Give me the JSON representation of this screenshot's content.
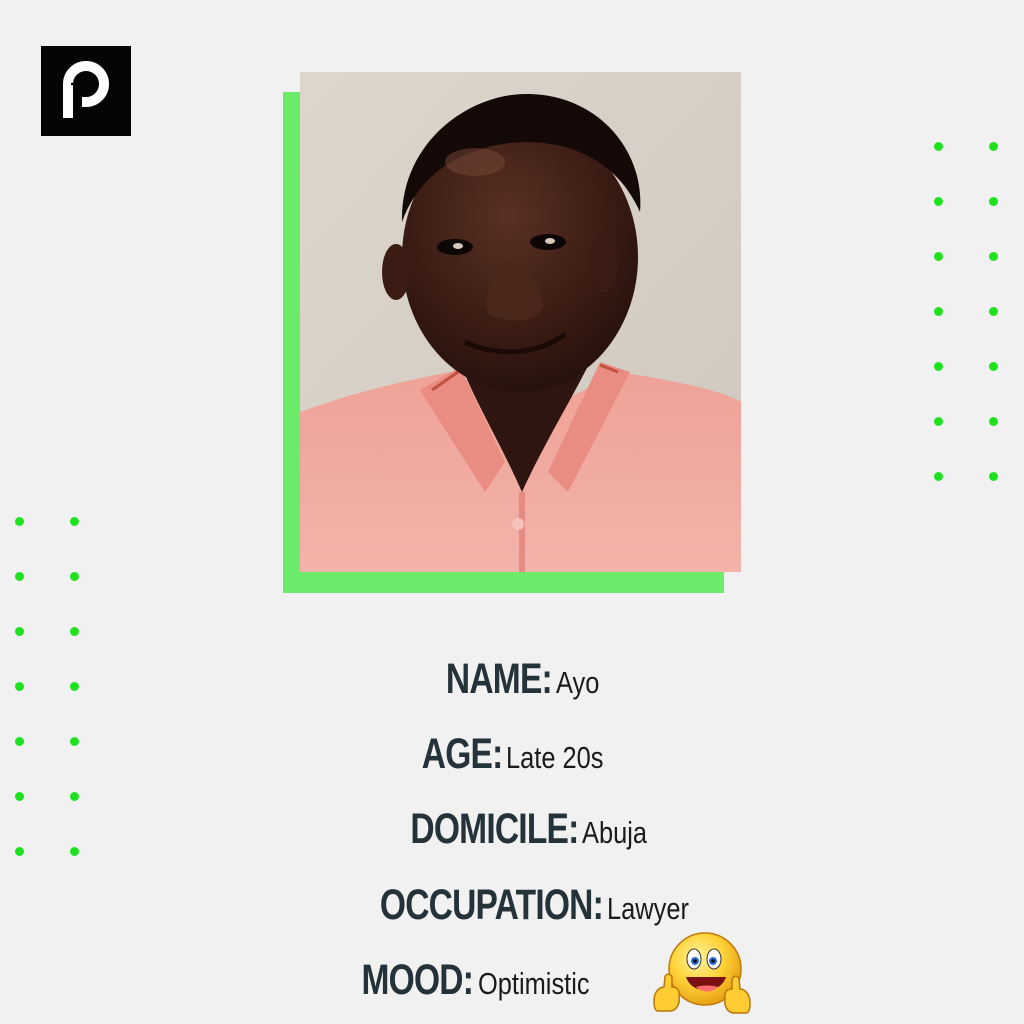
{
  "logo": {
    "icon": "pulse-p-logo-icon"
  },
  "photo": {
    "description_icon": "portrait-photo"
  },
  "profile": {
    "name_label": "NAME:",
    "name_value": "Ayo",
    "age_label": "AGE:",
    "age_value": "Late 20s",
    "domicile_label": "DOMICILE:",
    "domicile_value": "Abuja",
    "occupation_label": "OCCUPATION:",
    "occupation_value": "Lawyer",
    "mood_label": "MOOD:",
    "mood_value": "Optimistic"
  },
  "colors": {
    "accent_green": "#6ceb6a",
    "dot_green": "#1fe21f",
    "label_color": "#24323a",
    "background": "#f1f1f1"
  }
}
